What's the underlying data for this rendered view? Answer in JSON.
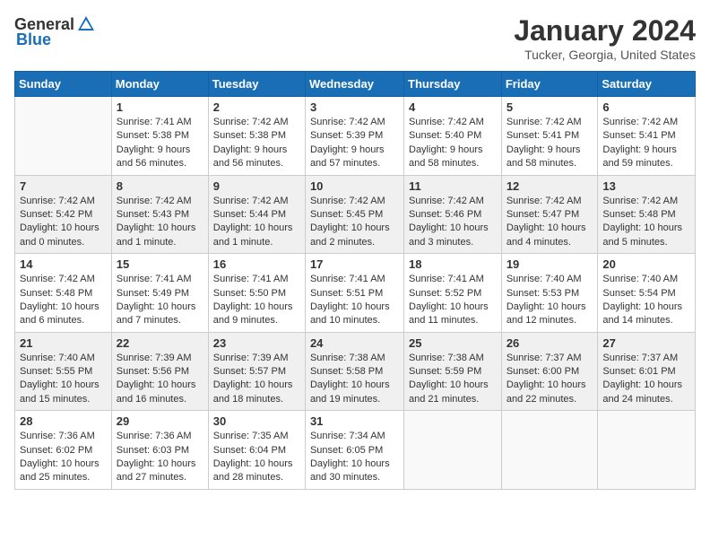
{
  "logo": {
    "general": "General",
    "blue": "Blue"
  },
  "title": "January 2024",
  "location": "Tucker, Georgia, United States",
  "headers": [
    "Sunday",
    "Monday",
    "Tuesday",
    "Wednesday",
    "Thursday",
    "Friday",
    "Saturday"
  ],
  "weeks": [
    [
      {
        "day": "",
        "sunrise": "",
        "sunset": "",
        "daylight": "",
        "empty": true
      },
      {
        "day": "1",
        "sunrise": "Sunrise: 7:41 AM",
        "sunset": "Sunset: 5:38 PM",
        "daylight": "Daylight: 9 hours and 56 minutes."
      },
      {
        "day": "2",
        "sunrise": "Sunrise: 7:42 AM",
        "sunset": "Sunset: 5:38 PM",
        "daylight": "Daylight: 9 hours and 56 minutes."
      },
      {
        "day": "3",
        "sunrise": "Sunrise: 7:42 AM",
        "sunset": "Sunset: 5:39 PM",
        "daylight": "Daylight: 9 hours and 57 minutes."
      },
      {
        "day": "4",
        "sunrise": "Sunrise: 7:42 AM",
        "sunset": "Sunset: 5:40 PM",
        "daylight": "Daylight: 9 hours and 58 minutes."
      },
      {
        "day": "5",
        "sunrise": "Sunrise: 7:42 AM",
        "sunset": "Sunset: 5:41 PM",
        "daylight": "Daylight: 9 hours and 58 minutes."
      },
      {
        "day": "6",
        "sunrise": "Sunrise: 7:42 AM",
        "sunset": "Sunset: 5:41 PM",
        "daylight": "Daylight: 9 hours and 59 minutes."
      }
    ],
    [
      {
        "day": "7",
        "sunrise": "Sunrise: 7:42 AM",
        "sunset": "Sunset: 5:42 PM",
        "daylight": "Daylight: 10 hours and 0 minutes."
      },
      {
        "day": "8",
        "sunrise": "Sunrise: 7:42 AM",
        "sunset": "Sunset: 5:43 PM",
        "daylight": "Daylight: 10 hours and 1 minute."
      },
      {
        "day": "9",
        "sunrise": "Sunrise: 7:42 AM",
        "sunset": "Sunset: 5:44 PM",
        "daylight": "Daylight: 10 hours and 1 minute."
      },
      {
        "day": "10",
        "sunrise": "Sunrise: 7:42 AM",
        "sunset": "Sunset: 5:45 PM",
        "daylight": "Daylight: 10 hours and 2 minutes."
      },
      {
        "day": "11",
        "sunrise": "Sunrise: 7:42 AM",
        "sunset": "Sunset: 5:46 PM",
        "daylight": "Daylight: 10 hours and 3 minutes."
      },
      {
        "day": "12",
        "sunrise": "Sunrise: 7:42 AM",
        "sunset": "Sunset: 5:47 PM",
        "daylight": "Daylight: 10 hours and 4 minutes."
      },
      {
        "day": "13",
        "sunrise": "Sunrise: 7:42 AM",
        "sunset": "Sunset: 5:48 PM",
        "daylight": "Daylight: 10 hours and 5 minutes."
      }
    ],
    [
      {
        "day": "14",
        "sunrise": "Sunrise: 7:42 AM",
        "sunset": "Sunset: 5:48 PM",
        "daylight": "Daylight: 10 hours and 6 minutes."
      },
      {
        "day": "15",
        "sunrise": "Sunrise: 7:41 AM",
        "sunset": "Sunset: 5:49 PM",
        "daylight": "Daylight: 10 hours and 7 minutes."
      },
      {
        "day": "16",
        "sunrise": "Sunrise: 7:41 AM",
        "sunset": "Sunset: 5:50 PM",
        "daylight": "Daylight: 10 hours and 9 minutes."
      },
      {
        "day": "17",
        "sunrise": "Sunrise: 7:41 AM",
        "sunset": "Sunset: 5:51 PM",
        "daylight": "Daylight: 10 hours and 10 minutes."
      },
      {
        "day": "18",
        "sunrise": "Sunrise: 7:41 AM",
        "sunset": "Sunset: 5:52 PM",
        "daylight": "Daylight: 10 hours and 11 minutes."
      },
      {
        "day": "19",
        "sunrise": "Sunrise: 7:40 AM",
        "sunset": "Sunset: 5:53 PM",
        "daylight": "Daylight: 10 hours and 12 minutes."
      },
      {
        "day": "20",
        "sunrise": "Sunrise: 7:40 AM",
        "sunset": "Sunset: 5:54 PM",
        "daylight": "Daylight: 10 hours and 14 minutes."
      }
    ],
    [
      {
        "day": "21",
        "sunrise": "Sunrise: 7:40 AM",
        "sunset": "Sunset: 5:55 PM",
        "daylight": "Daylight: 10 hours and 15 minutes."
      },
      {
        "day": "22",
        "sunrise": "Sunrise: 7:39 AM",
        "sunset": "Sunset: 5:56 PM",
        "daylight": "Daylight: 10 hours and 16 minutes."
      },
      {
        "day": "23",
        "sunrise": "Sunrise: 7:39 AM",
        "sunset": "Sunset: 5:57 PM",
        "daylight": "Daylight: 10 hours and 18 minutes."
      },
      {
        "day": "24",
        "sunrise": "Sunrise: 7:38 AM",
        "sunset": "Sunset: 5:58 PM",
        "daylight": "Daylight: 10 hours and 19 minutes."
      },
      {
        "day": "25",
        "sunrise": "Sunrise: 7:38 AM",
        "sunset": "Sunset: 5:59 PM",
        "daylight": "Daylight: 10 hours and 21 minutes."
      },
      {
        "day": "26",
        "sunrise": "Sunrise: 7:37 AM",
        "sunset": "Sunset: 6:00 PM",
        "daylight": "Daylight: 10 hours and 22 minutes."
      },
      {
        "day": "27",
        "sunrise": "Sunrise: 7:37 AM",
        "sunset": "Sunset: 6:01 PM",
        "daylight": "Daylight: 10 hours and 24 minutes."
      }
    ],
    [
      {
        "day": "28",
        "sunrise": "Sunrise: 7:36 AM",
        "sunset": "Sunset: 6:02 PM",
        "daylight": "Daylight: 10 hours and 25 minutes."
      },
      {
        "day": "29",
        "sunrise": "Sunrise: 7:36 AM",
        "sunset": "Sunset: 6:03 PM",
        "daylight": "Daylight: 10 hours and 27 minutes."
      },
      {
        "day": "30",
        "sunrise": "Sunrise: 7:35 AM",
        "sunset": "Sunset: 6:04 PM",
        "daylight": "Daylight: 10 hours and 28 minutes."
      },
      {
        "day": "31",
        "sunrise": "Sunrise: 7:34 AM",
        "sunset": "Sunset: 6:05 PM",
        "daylight": "Daylight: 10 hours and 30 minutes."
      },
      {
        "day": "",
        "sunrise": "",
        "sunset": "",
        "daylight": "",
        "empty": true
      },
      {
        "day": "",
        "sunrise": "",
        "sunset": "",
        "daylight": "",
        "empty": true
      },
      {
        "day": "",
        "sunrise": "",
        "sunset": "",
        "daylight": "",
        "empty": true
      }
    ]
  ]
}
